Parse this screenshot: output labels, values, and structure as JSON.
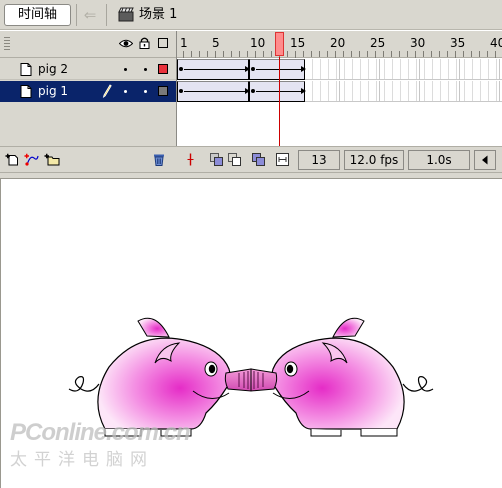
{
  "toolbar": {
    "timeline_button": "时间轴",
    "scene_label": "场景 1"
  },
  "layers": [
    {
      "name": "pig 2",
      "color": "#e8323c",
      "selected": false
    },
    {
      "name": "pig 1",
      "color": "#7a7a7a",
      "selected": true
    }
  ],
  "ruler": {
    "labels": [
      "1",
      "5",
      "10",
      "15",
      "20",
      "25",
      "30",
      "35",
      "40"
    ]
  },
  "status": {
    "current_frame": "13",
    "frame_rate": "12.0 fps",
    "elapsed_time": "1.0s"
  },
  "watermark": {
    "logo": "PConline.com.cn",
    "text": "太平洋电脑网"
  },
  "colors": {
    "panel": "#d9d7cf",
    "selection": "#0a246a",
    "playhead": "#ff8c8c",
    "pig_pink": "#f06fd8"
  }
}
